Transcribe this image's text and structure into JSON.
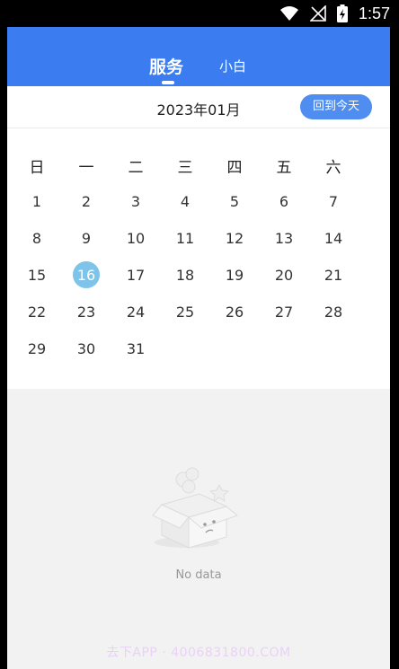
{
  "status_bar": {
    "time": "1:57",
    "icons": [
      "wifi-icon",
      "signal-off-icon",
      "battery-charging-icon"
    ]
  },
  "header": {
    "tabs": [
      {
        "label": "服务",
        "active": true
      },
      {
        "label": "小白",
        "active": false
      }
    ],
    "color": "#3b7cf0"
  },
  "month_bar": {
    "month": "2023年01月",
    "today_button": "回到今天"
  },
  "calendar": {
    "weekdays": [
      "日",
      "一",
      "二",
      "三",
      "四",
      "五",
      "六"
    ],
    "days": [
      "1",
      "2",
      "3",
      "4",
      "5",
      "6",
      "7",
      "8",
      "9",
      "10",
      "11",
      "12",
      "13",
      "14",
      "15",
      "16",
      "17",
      "18",
      "19",
      "20",
      "21",
      "22",
      "23",
      "24",
      "25",
      "26",
      "27",
      "28",
      "29",
      "30",
      "31"
    ],
    "selected_day": "16",
    "selected_color": "#7ec4ea"
  },
  "empty_state": {
    "text": "No data",
    "icon": "empty-box-icon"
  },
  "watermark": "去下APP · 4006831800.COM"
}
